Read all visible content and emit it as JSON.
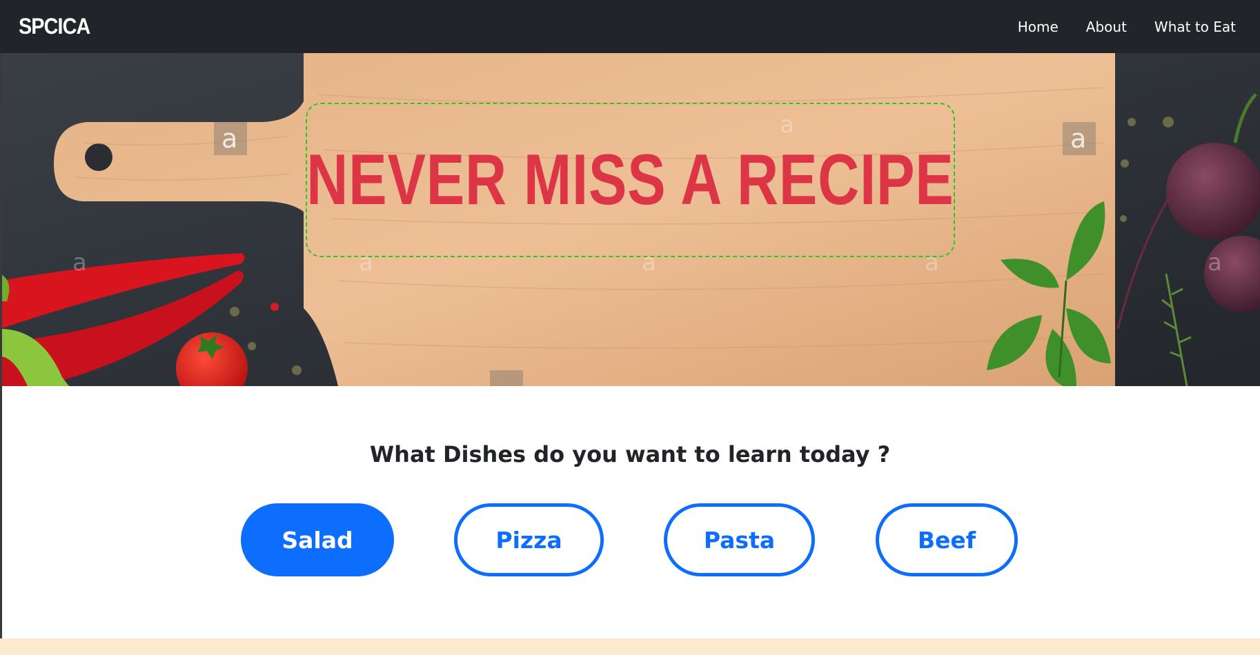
{
  "navbar": {
    "brand": "SPCICA",
    "links": [
      "Home",
      "About",
      "What to Eat"
    ]
  },
  "hero": {
    "headline": "NEVER MISS A RECIPE",
    "headline_color": "#dc3545",
    "frame_color": "#22cc22"
  },
  "main": {
    "prompt": "What Dishes do you want to learn today ?",
    "dish_buttons": [
      {
        "label": "Salad",
        "active": true
      },
      {
        "label": "Pizza",
        "active": false
      },
      {
        "label": "Pasta",
        "active": false
      },
      {
        "label": "Beef",
        "active": false
      }
    ]
  },
  "colors": {
    "navbar_bg": "#212529",
    "accent": "#0d6efd",
    "bottom_strip": "#fdebd0"
  },
  "icons": {
    "watermark": "a"
  }
}
